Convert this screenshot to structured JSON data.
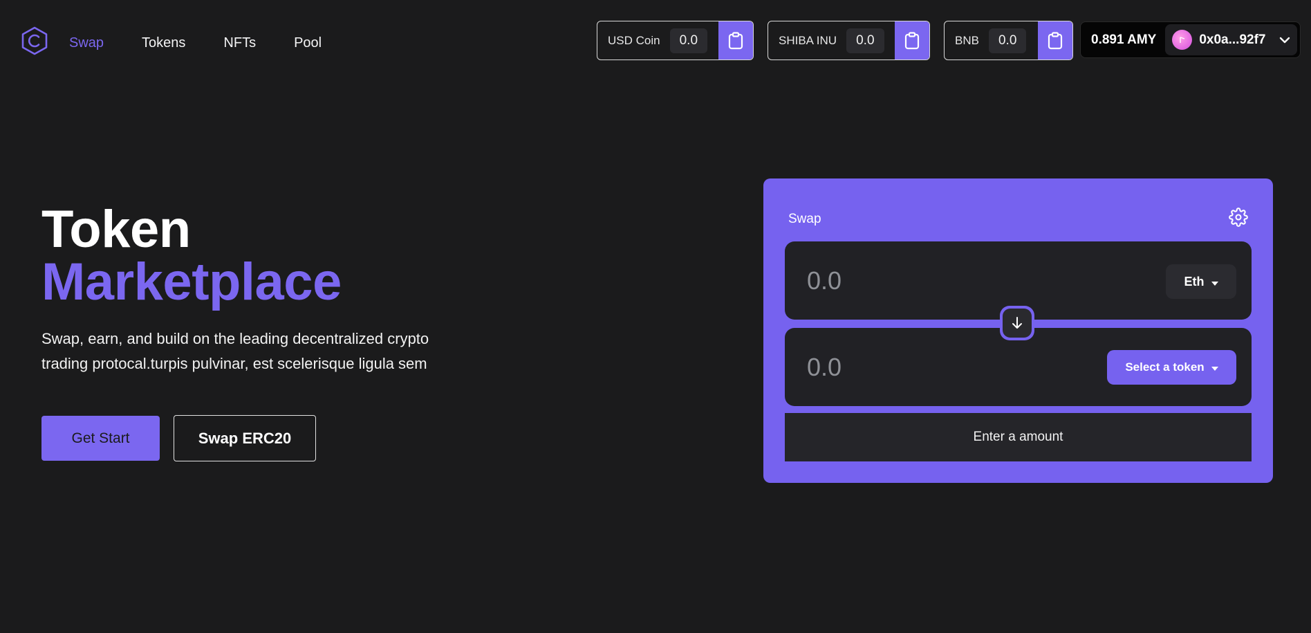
{
  "nav": {
    "items": [
      {
        "label": "Swap",
        "active": true
      },
      {
        "label": "Tokens",
        "active": false
      },
      {
        "label": "NFTs",
        "active": false
      },
      {
        "label": "Pool",
        "active": false
      }
    ]
  },
  "balances": [
    {
      "name": "USD Coin",
      "value": "0.0",
      "icon": "clipboard-icon"
    },
    {
      "name": "SHIBA INU",
      "value": "0.0",
      "icon": "clipboard-icon"
    },
    {
      "name": "BNB",
      "value": "0.0",
      "icon": "clipboard-icon"
    }
  ],
  "wallet": {
    "balance": "0.891 AMY",
    "address": "0x0a...92f7"
  },
  "hero": {
    "title_line1": "Token",
    "title_line2": "Marketplace",
    "description_line1": "Swap, earn, and build on the leading decentralized crypto",
    "description_line2": "trading protocal.turpis pulvinar, est scelerisque ligula sem",
    "primary_button": "Get Start",
    "secondary_button": "Swap ERC20"
  },
  "swap_card": {
    "title": "Swap",
    "from_amount": "0.0",
    "from_token": "Eth",
    "to_amount": "0.0",
    "to_token": "Select a token",
    "submit_label": "Enter a amount"
  },
  "colors": {
    "accent": "#7b67f0",
    "background": "#1b1b1c",
    "panel": "#212125"
  }
}
